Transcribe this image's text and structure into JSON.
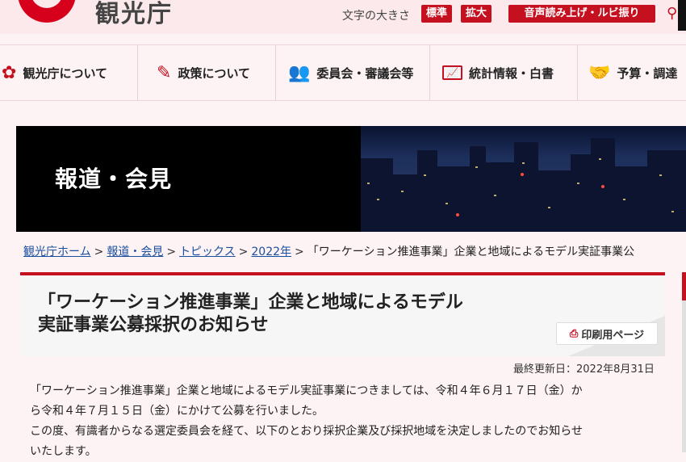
{
  "header": {
    "site_name": "観光庁",
    "font_size_label": "文字の大きさ",
    "font_size_standard": "標準",
    "font_size_large": "拡大",
    "voice_button": "音声読み上げ・ルビ振り"
  },
  "nav": {
    "items": [
      {
        "label": "観光庁について",
        "icon": "flower-icon"
      },
      {
        "label": "政策について",
        "icon": "pencil-icon"
      },
      {
        "label": "委員会・審議会等",
        "icon": "people-icon"
      },
      {
        "label": "統計情報・白書",
        "icon": "chart-icon"
      },
      {
        "label": "予算・調達",
        "icon": "handshake-icon"
      }
    ]
  },
  "banner": {
    "title": "報道・会見"
  },
  "breadcrumb": {
    "home": "観光庁ホーム",
    "press": "報道・会見",
    "topics": "トピックス",
    "year": "2022年",
    "current": "「ワーケーション推進事業」企業と地域によるモデル実証事業公"
  },
  "article": {
    "title_line1": "「ワーケーション推進事業」企業と地域によるモデル",
    "title_line2": "実証事業公募採択のお知らせ",
    "print_label": "印刷用ページ",
    "updated": "最終更新日：2022年8月31日",
    "para1_line1": "「ワーケーション推進事業」企業と地域によるモデル実証事業につきましては、令和４年６月１７日（金）か",
    "para1_line2": "ら令和４年７月１５日（金）にかけて公募を行いました。",
    "para2_line1": "この度、有識者からなる選定委員会を経て、以下のとおり採択企業及び採択地域を決定しましたのでお知らせ",
    "para2_line2": "いたします。"
  },
  "colors": {
    "brand_red": "#c4101f",
    "link_blue": "#1a4fa0"
  }
}
